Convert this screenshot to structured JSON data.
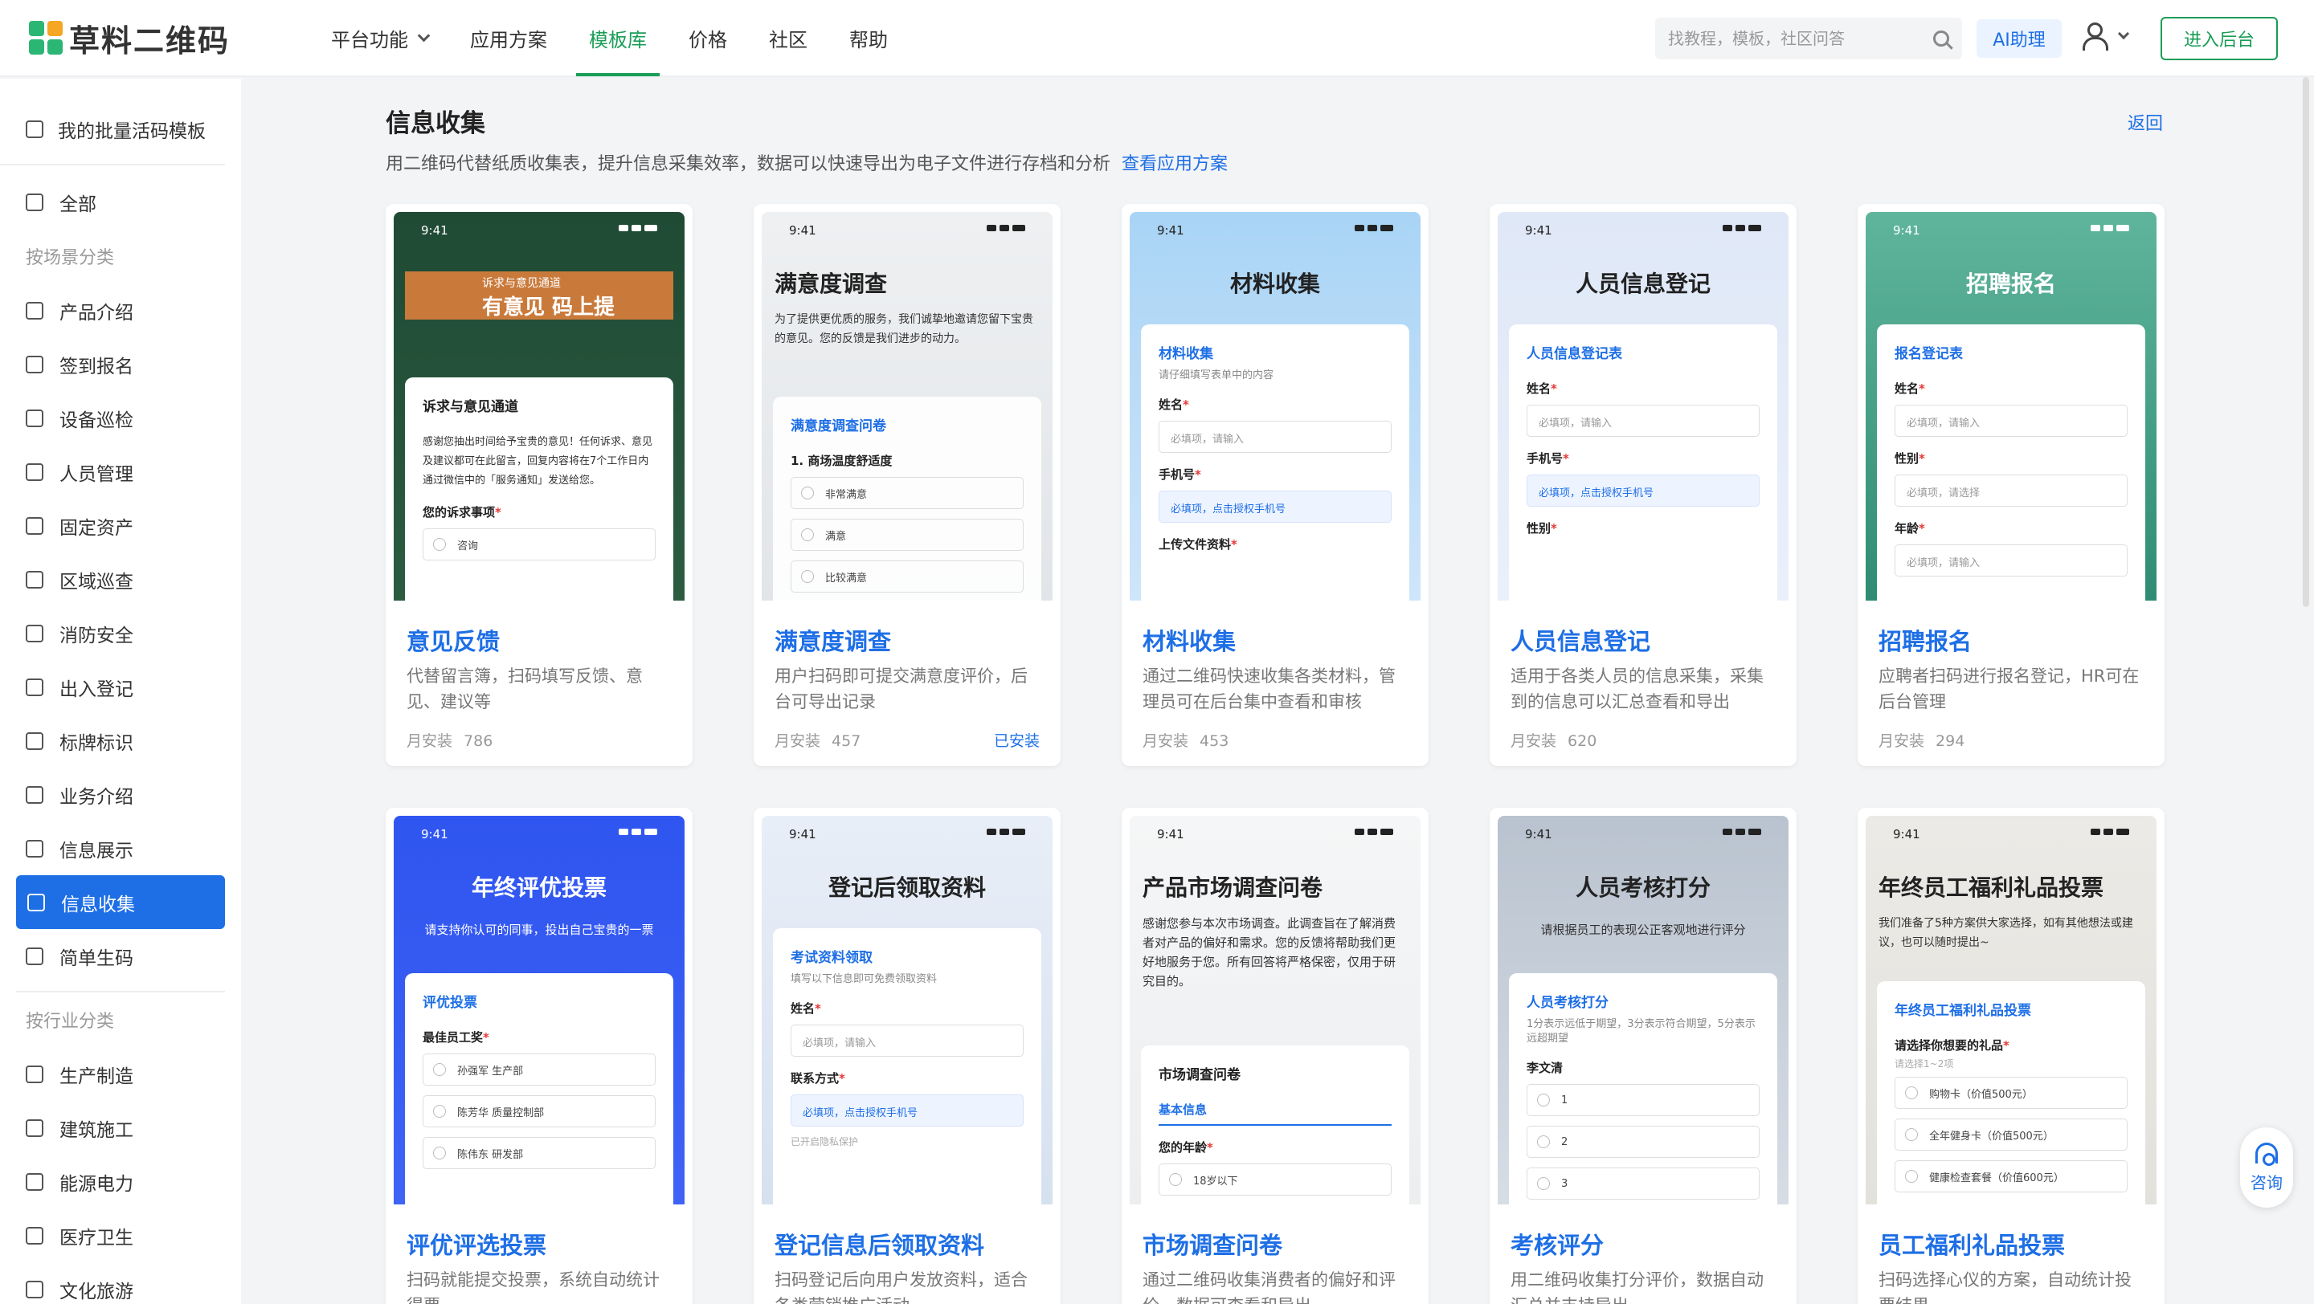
{
  "header": {
    "logo_text": "草料二维码",
    "nav": [
      "平台功能",
      "应用方案",
      "模板库",
      "价格",
      "社区",
      "帮助"
    ],
    "active_nav": "模板库",
    "search_placeholder": "找教程，模板，社区问答",
    "ai_button": "AI助理",
    "enter_button": "进入后台"
  },
  "sidebar": {
    "top_item": "我的批量活码模板",
    "all_item": "全部",
    "group1": "按场景分类",
    "scene_items": [
      "产品介绍",
      "签到报名",
      "设备巡检",
      "人员管理",
      "固定资产",
      "区域巡查",
      "消防安全",
      "出入登记",
      "标牌标识",
      "业务介绍",
      "信息展示",
      "信息收集",
      "简单生码"
    ],
    "active_item": "信息收集",
    "group2": "按行业分类",
    "industry_items": [
      "生产制造",
      "建筑施工",
      "能源电力",
      "医疗卫生",
      "文化旅游"
    ]
  },
  "main": {
    "title": "信息收集",
    "back": "返回",
    "description": "用二维码代替纸质收集表，提升信息采集效率，数据可以快速导出为电子文件进行存档和分析",
    "solution_link": "查看应用方案",
    "meta_label": "月安装",
    "installed_label": "已安装",
    "cards": [
      {
        "name": "意见反馈",
        "desc": "代替留言簿，扫码填写反馈、意见、建议等",
        "installs": "786",
        "thumb": {
          "time": "9:41",
          "title": "有意见 码上提",
          "badge": "诉求与意见通道",
          "form_title": "诉求与意见通道",
          "intro": "感谢您抽出时间给予宝贵的意见！任何诉求、意见及建议都可在此留言，回复内容将在7个工作日内通过微信中的「服务通知」发送给您。",
          "field": "您的诉求事项",
          "option": "咨询"
        }
      },
      {
        "name": "满意度调查",
        "desc": "用户扫码即可提交满意度评价，后台可导出记录",
        "installs": "457",
        "installed": true,
        "thumb": {
          "time": "9:41",
          "title": "满意度调查",
          "sub": "为了提供更优质的服务，我们诚挚地邀请您留下宝贵的意见。您的反馈是我们进步的动力。",
          "form_title": "满意度调查问卷",
          "field": "1. 商场温度舒适度",
          "options": [
            "非常满意",
            "满意",
            "比较满意"
          ]
        }
      },
      {
        "name": "材料收集",
        "desc": "通过二维码快速收集各类材料，管理员可在后台集中查看和审核",
        "installs": "453",
        "thumb": {
          "time": "9:41",
          "title": "材料收集",
          "form_title": "材料收集",
          "form_sub": "请仔细填写表单中的内容",
          "f1": "姓名",
          "p1": "必填项，请输入",
          "f2": "手机号",
          "p2": "必填项，点击授权手机号",
          "f3": "上传文件资料"
        }
      },
      {
        "name": "人员信息登记",
        "desc": "适用于各类人员的信息采集，采集到的信息可以汇总查看和导出",
        "installs": "620",
        "thumb": {
          "time": "9:41",
          "title": "人员信息登记",
          "form_title": "人员信息登记表",
          "f1": "姓名",
          "p1": "必填项，请输入",
          "f2": "手机号",
          "p2": "必填项，点击授权手机号",
          "f3": "性别"
        }
      },
      {
        "name": "招聘报名",
        "desc": "应聘者扫码进行报名登记，HR可在后台管理",
        "installs": "294",
        "thumb": {
          "time": "9:41",
          "title": "招聘报名",
          "form_title": "报名登记表",
          "f1": "姓名",
          "p1": "必填项，请输入",
          "f2": "性别",
          "p2": "必填项，请选择",
          "f3": "年龄",
          "p3": "必填项，请输入"
        }
      },
      {
        "name": "评优评选投票",
        "desc": "扫码就能提交投票，系统自动统计得票",
        "thumb": {
          "time": "9:41",
          "title": "年终评优投票",
          "sub": "请支持你认可的同事，投出自己宝贵的一票",
          "form_title": "评优投票",
          "field": "最佳员工奖",
          "options": [
            "孙强军 生产部",
            "陈芳华 质量控制部",
            "陈伟东 研发部"
          ]
        }
      },
      {
        "name": "登记信息后领取资料",
        "desc": "扫码登记后向用户发放资料，适合各类营销推广活动",
        "thumb": {
          "time": "9:41",
          "title": "登记后领取资料",
          "form_title": "考试资料领取",
          "form_sub": "填写以下信息即可免费领取资料",
          "f1": "姓名",
          "p1": "必填项，请输入",
          "f2": "联系方式",
          "p2": "必填项，点击授权手机号",
          "note": "已开启隐私保护"
        }
      },
      {
        "name": "市场调查问卷",
        "desc": "通过二维码收集消费者的偏好和评价，数据可查看和导出",
        "thumb": {
          "time": "9:41",
          "title": "产品市场调查问卷",
          "sub": "感谢您参与本次市场调查。此调查旨在了解消费者对产品的偏好和需求。您的反馈将帮助我们更好地服务于您。所有回答将严格保密，仅用于研究目的。",
          "form_title": "市场调查问卷",
          "section": "基本信息",
          "field": "您的年龄",
          "option": "18岁以下"
        }
      },
      {
        "name": "考核评分",
        "desc": "用二维码收集打分评价，数据自动汇总并支持导出",
        "thumb": {
          "time": "9:41",
          "title": "人员考核打分",
          "sub": "请根据员工的表现公正客观地进行评分",
          "form_title": "人员考核打分",
          "form_sub": "1分表示远低于期望，3分表示符合期望，5分表示远超期望",
          "field": "李文清",
          "options": [
            "1",
            "2",
            "3"
          ]
        }
      },
      {
        "name": "员工福利礼品投票",
        "desc": "扫码选择心仪的方案，自动统计投票结果",
        "thumb": {
          "time": "9:41",
          "title": "年终员工福利礼品投票",
          "sub": "我们准备了5种方案供大家选择，如有其他想法或建议，也可以随时提出~",
          "form_title": "年终员工福利礼品投票",
          "field": "请选择你想要的礼品",
          "hint": "请选择1~2项",
          "options": [
            "购物卡（价值500元）",
            "全年健身卡（价值500元）",
            "健康检查套餐（价值600元）"
          ]
        }
      }
    ]
  },
  "consult": "咨询",
  "colors": {
    "brand_green": "#1a9d57",
    "accent_blue": "#1e6fe6"
  }
}
